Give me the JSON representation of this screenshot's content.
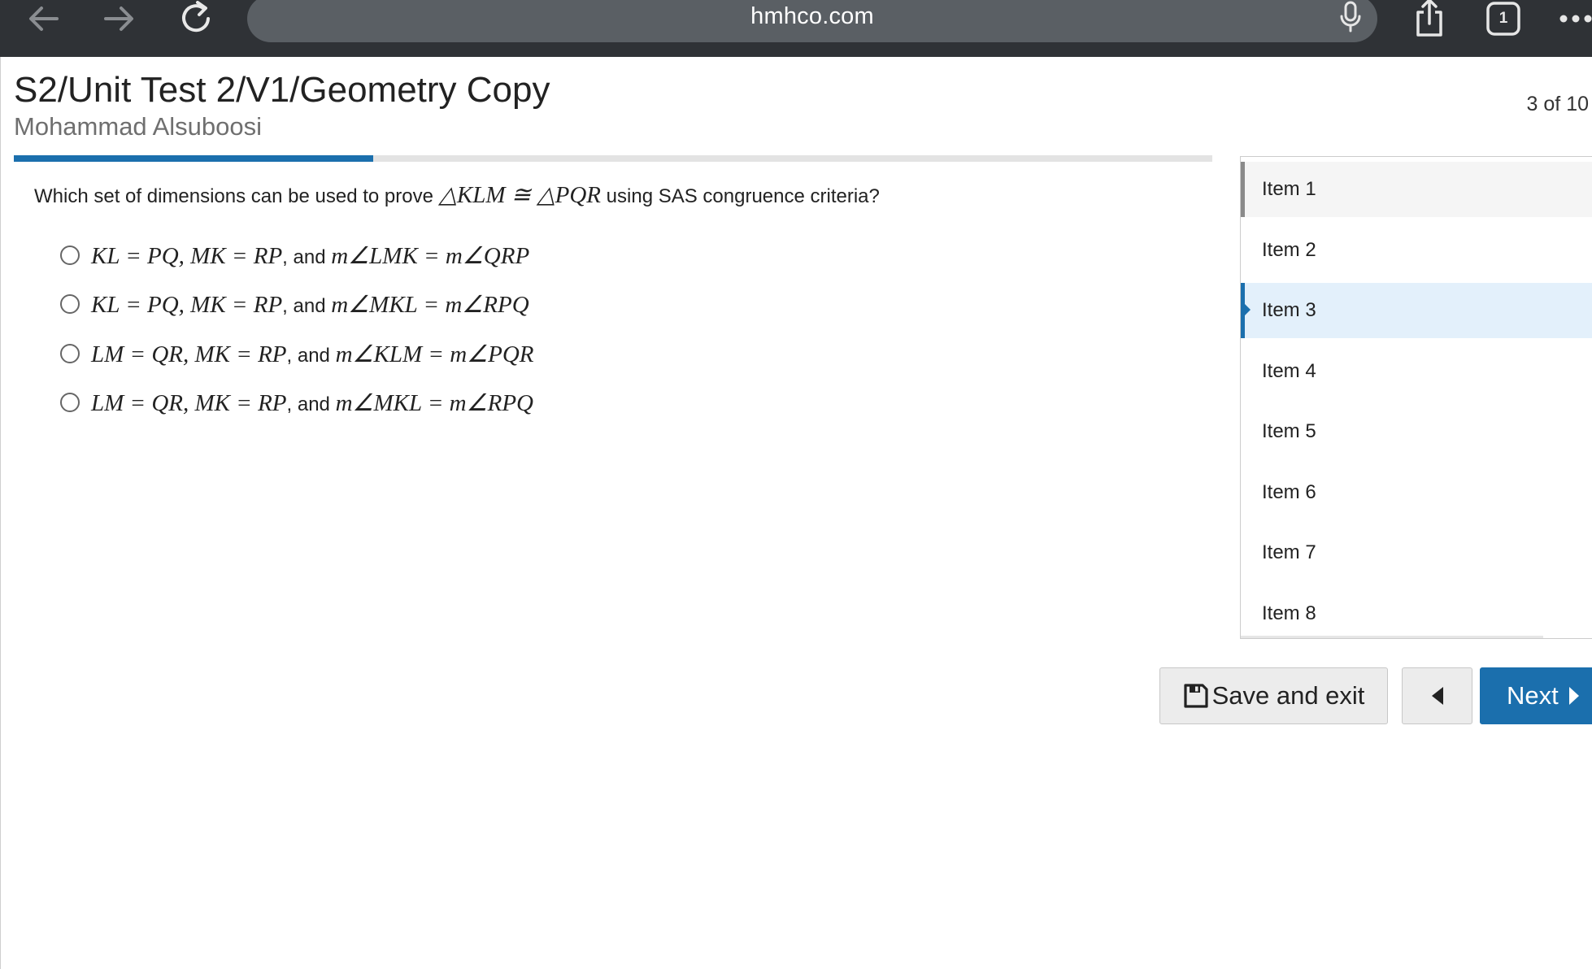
{
  "browser": {
    "url": "hmhco.com",
    "tab_count": "1"
  },
  "test": {
    "title": "S2/Unit Test 2/V1/Geometry Copy",
    "student": "Mohammad Alsuboosi",
    "counter": "3 of 10",
    "progress_fraction": 0.3
  },
  "question": {
    "prefix": "Which set of dimensions can be used to prove ",
    "statement": "△KLM ≅ △PQR",
    "suffix": " using SAS congruence criteria?"
  },
  "options": [
    {
      "math1": "KL = PQ, MK = RP",
      "joiner": ", and ",
      "math2": "m∠LMK = m∠QRP"
    },
    {
      "math1": "KL = PQ, MK = RP",
      "joiner": ", and ",
      "math2": "m∠MKL = m∠RPQ"
    },
    {
      "math1": "LM = QR, MK = RP",
      "joiner": ", and ",
      "math2": "m∠KLM = m∠PQR"
    },
    {
      "math1": "LM = QR, MK = RP",
      "joiner": ", and ",
      "math2": "m∠MKL = m∠RPQ"
    }
  ],
  "items": [
    {
      "label": "Item 1",
      "state": "visited"
    },
    {
      "label": "Item 2",
      "state": ""
    },
    {
      "label": "Item 3",
      "state": "current"
    },
    {
      "label": "Item 4",
      "state": ""
    },
    {
      "label": "Item 5",
      "state": ""
    },
    {
      "label": "Item 6",
      "state": ""
    },
    {
      "label": "Item 7",
      "state": ""
    },
    {
      "label": "Item 8",
      "state": ""
    }
  ],
  "buttons": {
    "save_exit": "Save and exit",
    "next": "Next"
  },
  "colors": {
    "accent": "#1b6fad",
    "chrome_bg": "#2f3236",
    "url_bar": "#5a5f64",
    "current_item_bg": "#e3f0fb"
  },
  "icons": {
    "back": "arrow-left-icon",
    "forward": "arrow-right-icon",
    "reload": "reload-icon",
    "mic": "microphone-icon",
    "share": "share-icon",
    "tabs": "tabs-icon",
    "more": "more-dots-icon",
    "save": "floppy-disk-icon",
    "prev": "caret-left-icon",
    "next": "caret-right-icon"
  }
}
